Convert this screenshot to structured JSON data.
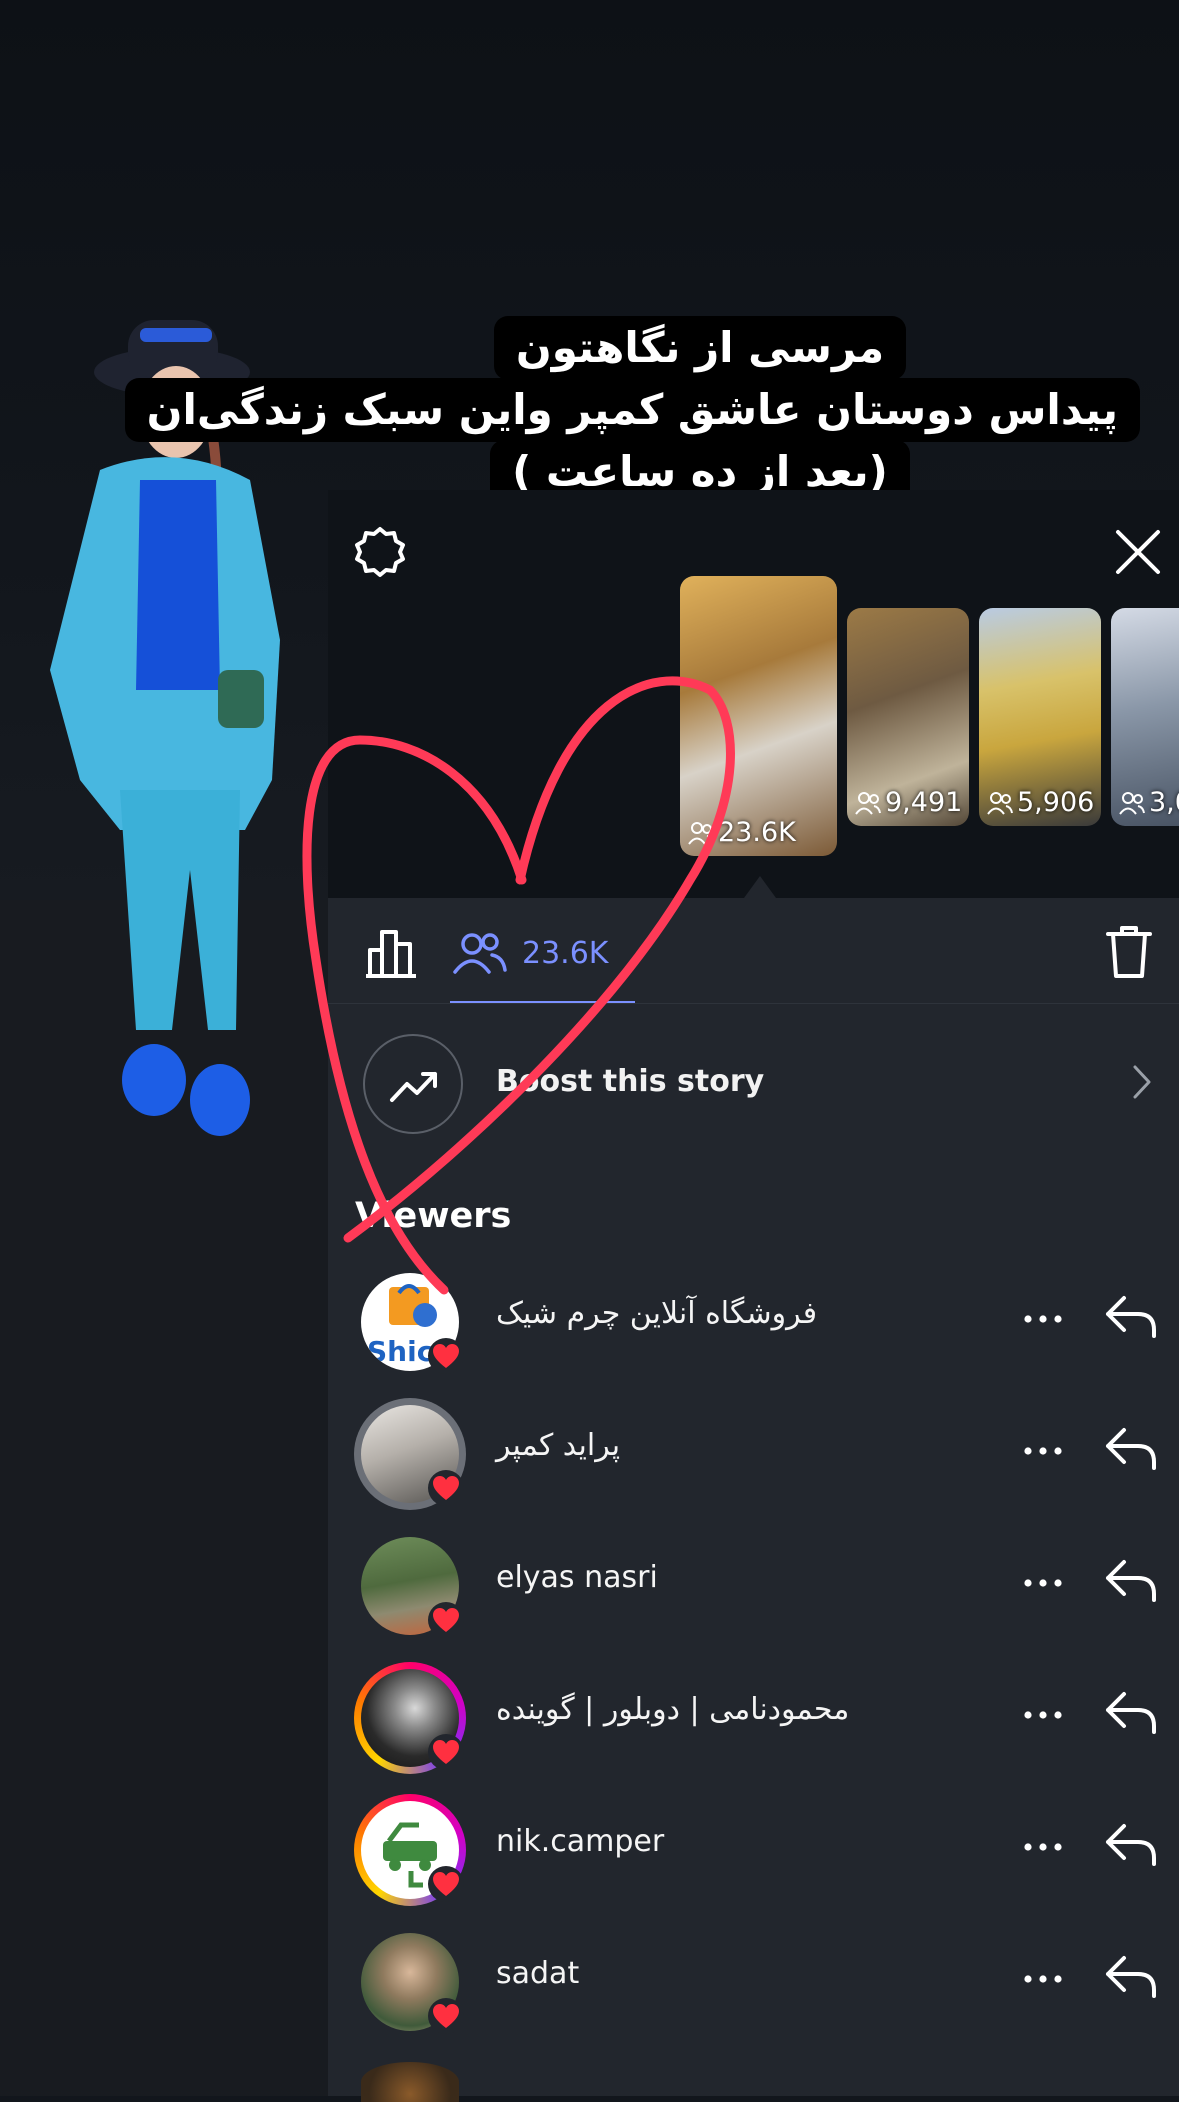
{
  "caption": {
    "line1": "مرسی از نگاهتون",
    "line2": "پیداس دوستان عاشق کمپر واین سبک زندگی‌ان",
    "line3": "(بعد از ده ساعت )"
  },
  "stories": {
    "thumbnails": [
      {
        "view_count": "23.6K",
        "selected": true
      },
      {
        "view_count": "9,491"
      },
      {
        "view_count": "5,906"
      },
      {
        "view_count": "3,0"
      }
    ]
  },
  "tabs": {
    "viewers_count": "23.6K"
  },
  "boost": {
    "label": "Boost this story"
  },
  "viewers": {
    "title": "Viewers",
    "items": [
      {
        "name": "فروشگاه آنلاین چرم شیک",
        "ring": "none",
        "avatar_text": "Shic",
        "liked": true
      },
      {
        "name": "پراید کمپر",
        "ring": "seen",
        "liked": true
      },
      {
        "name": "elyas nasri",
        "ring": "none",
        "liked": true
      },
      {
        "name": "محمودنامی | دوبلور | گوینده",
        "ring": "story",
        "liked": true
      },
      {
        "name": "nik.camper",
        "ring": "story",
        "liked": true
      },
      {
        "name": "sadat",
        "ring": "none",
        "liked": true
      }
    ]
  },
  "colors": {
    "accent": "#7b90ff",
    "heart": "#ff3040",
    "sheet_bg": "#22262d"
  }
}
